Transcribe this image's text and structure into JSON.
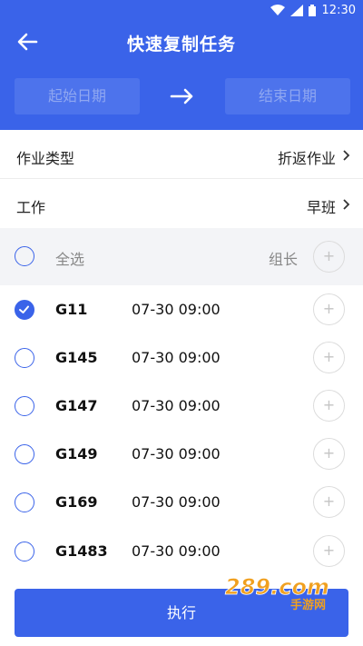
{
  "status": {
    "time": "12:30"
  },
  "header": {
    "title": "快速复制任务",
    "start_date_placeholder": "起始日期",
    "end_date_placeholder": "结束日期"
  },
  "form": {
    "job_type_label": "作业类型",
    "job_type_value": "折返作业",
    "work_label": "工作",
    "work_value": "早班"
  },
  "select_all": {
    "label": "全选",
    "group_leader": "组长",
    "plus": "+"
  },
  "trains": [
    {
      "train": "G11",
      "time": "07-30 09:00",
      "checked": true
    },
    {
      "train": "G145",
      "time": "07-30 09:00",
      "checked": false
    },
    {
      "train": "G147",
      "time": "07-30 09:00",
      "checked": false
    },
    {
      "train": "G149",
      "time": "07-30 09:00",
      "checked": false
    },
    {
      "train": "G169",
      "time": "07-30 09:00",
      "checked": false
    },
    {
      "train": "G1483",
      "time": "07-30 09:00",
      "checked": false
    }
  ],
  "plus_label": "+",
  "footer": {
    "execute_label": "执行"
  },
  "watermark": {
    "text": "289.com",
    "subtext": "手游网"
  },
  "colors": {
    "primary": "#3a63e9",
    "background": "#f3f4f7"
  }
}
